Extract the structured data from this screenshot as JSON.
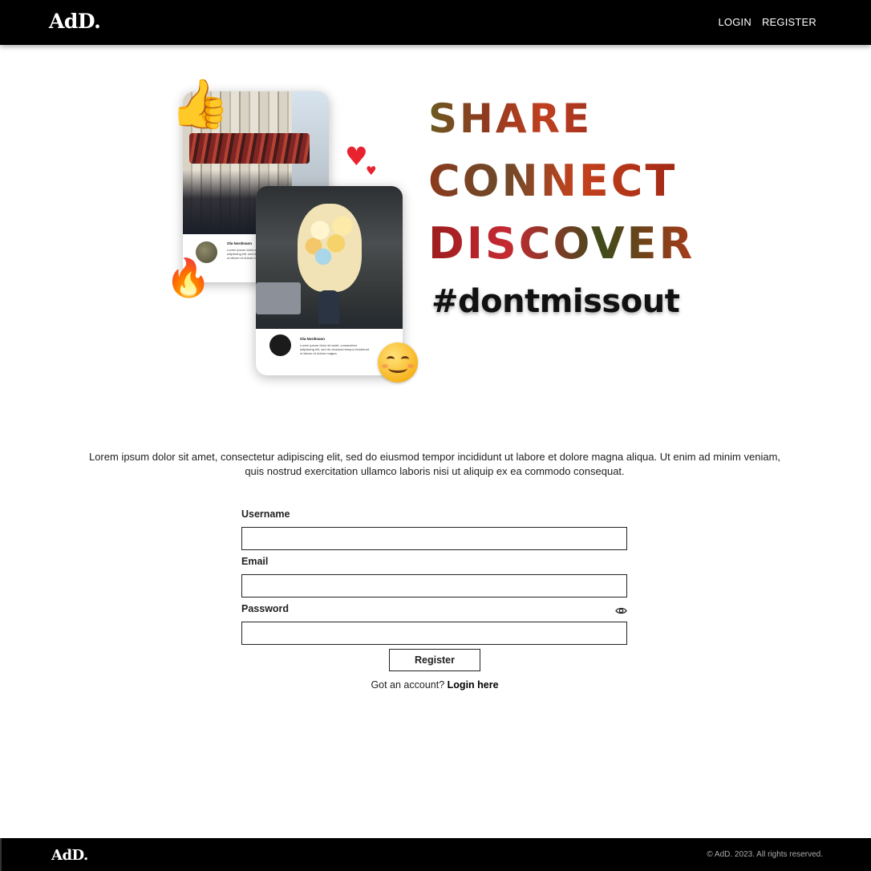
{
  "header": {
    "logo": "AdD.",
    "nav": {
      "login": "LOGIN",
      "register": "REGISTER"
    }
  },
  "hero": {
    "headlines": [
      "SHARE",
      "CONNECT",
      "DISCOVER"
    ],
    "hashtag": "#dontmissout",
    "cards": [
      {
        "author": "Ola Nordmann",
        "text": "Lorem ipsum dolor sit amet, consectetur adipiscing elit, sed do eiusmod tempor incididunt ut labore et dolore magna."
      },
      {
        "author": "Ola Nordmann",
        "text": "Lorem ipsum dolor sit amet, consectetur adipiscing elit, sed do eiusmod tempor incididunt ut labore et dolore magna."
      }
    ],
    "card_reaction_icon": "☺",
    "emojis": {
      "thumb": "👍",
      "heart": "♥",
      "fire": "🔥"
    }
  },
  "intro": "Lorem ipsum dolor sit amet, consectetur adipiscing elit, sed do eiusmod tempor incididunt ut labore et dolore magna aliqua. Ut enim ad minim veniam, quis nostrud exercitation ullamco laboris nisi ut aliquip ex ea commodo consequat.",
  "form": {
    "username_label": "Username",
    "username_value": "",
    "email_label": "Email",
    "email_value": "",
    "password_label": "Password",
    "password_value": "",
    "password_toggle_icon": "eye-icon",
    "submit_label": "Register",
    "switch_prompt": "Got an account?",
    "switch_link": "Login here"
  },
  "footer": {
    "logo": "AdD.",
    "copyright": "© AdD. 2023. All rights reserved."
  }
}
